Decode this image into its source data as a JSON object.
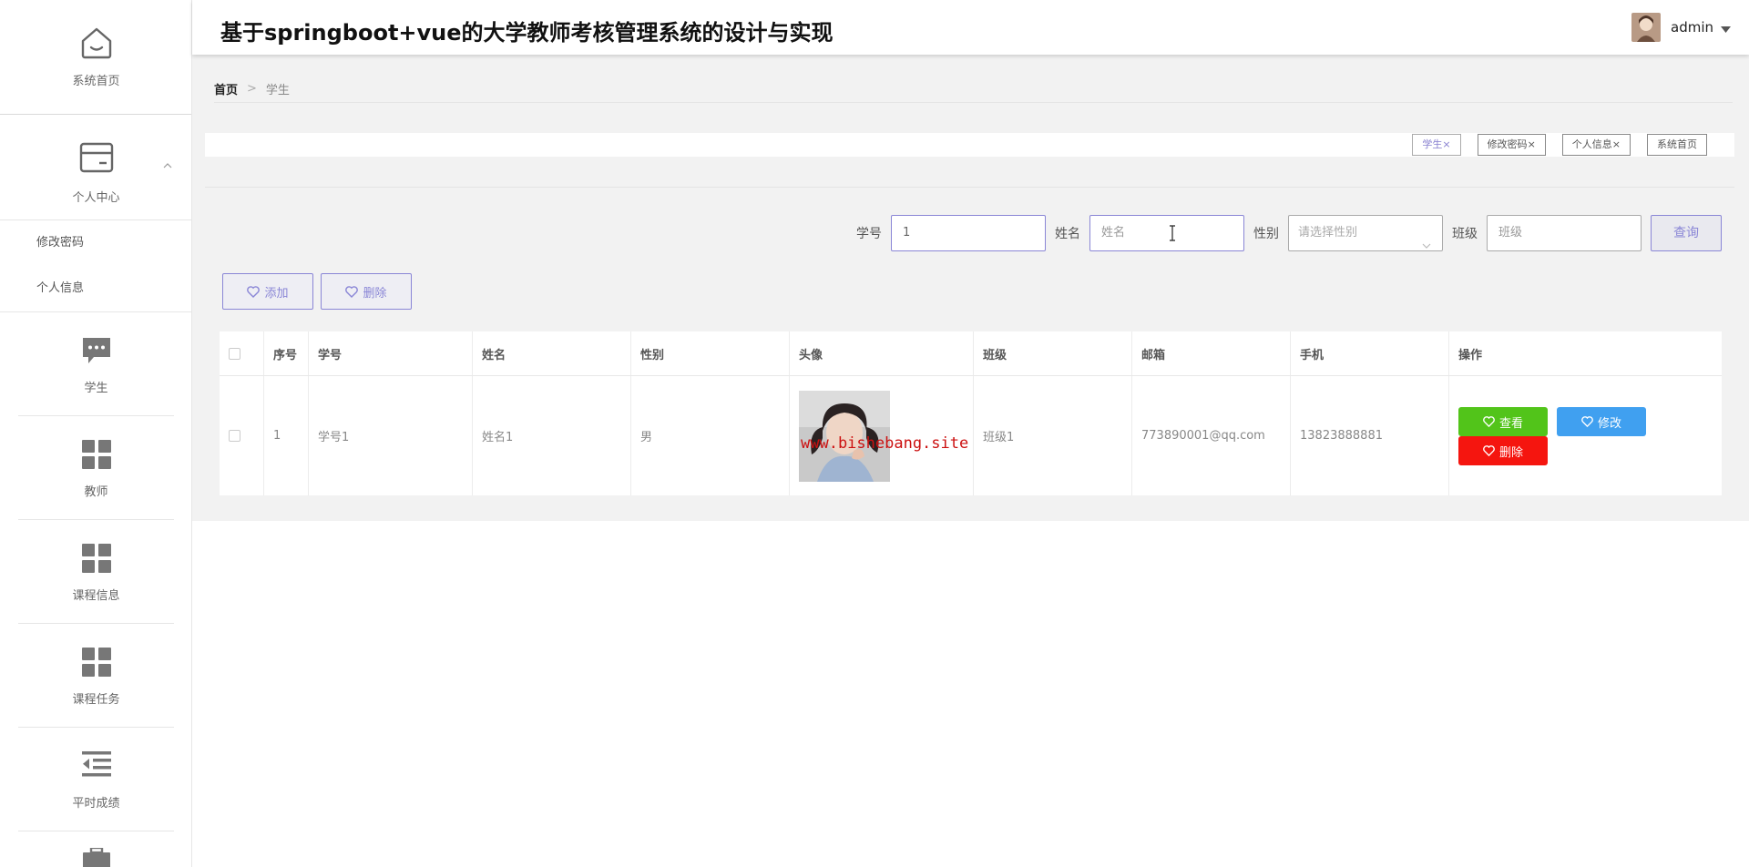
{
  "header": {
    "title": "基于springboot+vue的大学教师考核管理系统的设计与实现",
    "username": "admin"
  },
  "sidebar": {
    "home": "系统首页",
    "personal": "个人中心",
    "personal_sub": [
      "修改密码",
      "个人信息"
    ],
    "items": [
      {
        "label": "学生",
        "icon": "chat-icon"
      },
      {
        "label": "教师",
        "icon": "grid-icon"
      },
      {
        "label": "课程信息",
        "icon": "grid-icon"
      },
      {
        "label": "课程任务",
        "icon": "grid-icon"
      },
      {
        "label": "平时成绩",
        "icon": "list-indent-icon"
      }
    ]
  },
  "breadcrumb": {
    "home": "首页",
    "sep": ">",
    "current": "学生"
  },
  "tags": [
    {
      "label": "学生",
      "closable": true
    },
    {
      "label": "修改密码",
      "closable": true
    },
    {
      "label": "个人信息",
      "closable": true
    },
    {
      "label": "系统首页",
      "closable": false
    }
  ],
  "search": {
    "fields": [
      {
        "label": "学号",
        "value": "1",
        "placeholder": ""
      },
      {
        "label": "姓名",
        "value": "",
        "placeholder": "姓名"
      },
      {
        "label": "性别",
        "value": "",
        "placeholder": "请选择性别"
      },
      {
        "label": "班级",
        "value": "",
        "placeholder": "班级"
      }
    ],
    "query_label": "查询"
  },
  "actions": {
    "add": "添加",
    "delete": "删除"
  },
  "table": {
    "columns": [
      "序号",
      "学号",
      "姓名",
      "性别",
      "头像",
      "班级",
      "邮箱",
      "手机",
      "操作"
    ],
    "rows": [
      {
        "index": "1",
        "student_no": "学号1",
        "name": "姓名1",
        "gender": "男",
        "watermark": "www.bishebang.site",
        "class": "班级1",
        "email": "773890001@qq.com",
        "phone": "13823888881"
      }
    ],
    "ops": {
      "view": "查看",
      "edit": "修改",
      "delete": "删除"
    }
  },
  "colors": {
    "accent": "#8a86d6",
    "view": "#52c41a",
    "edit": "#40a0f0",
    "delete": "#f5150f"
  }
}
